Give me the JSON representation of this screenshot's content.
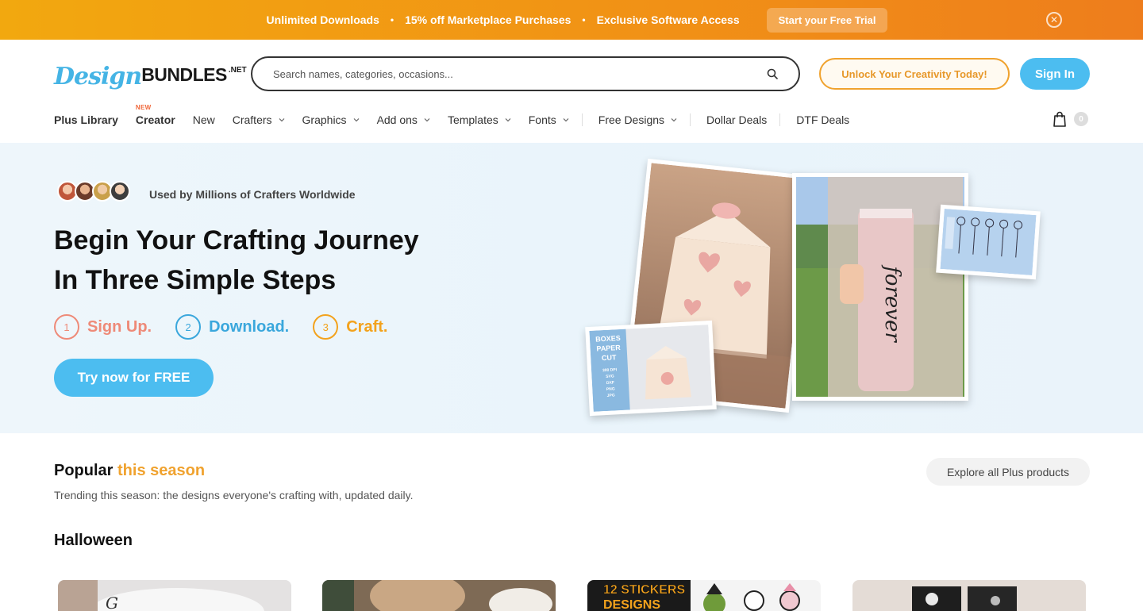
{
  "promo": {
    "items": [
      "Unlimited Downloads",
      "15% off Marketplace Purchases",
      "Exclusive Software Access"
    ],
    "separator": "•",
    "cta": "Start your Free Trial",
    "close_glyph": "✕"
  },
  "header": {
    "logo": {
      "part1": "Design",
      "part2": "BUNDLES",
      "part3": ".NET"
    },
    "search_placeholder": "Search names, categories, occasions...",
    "unlock_label": "Unlock Your Creativity Today!",
    "signin_label": "Sign In",
    "cart_count": "0"
  },
  "nav": {
    "items": [
      {
        "label": "Plus Library"
      },
      {
        "label": "Creator",
        "badge": "NEW"
      },
      {
        "label": "New"
      },
      {
        "label": "Crafters"
      },
      {
        "label": "Graphics"
      },
      {
        "label": "Add ons"
      },
      {
        "label": "Templates"
      },
      {
        "label": "Fonts"
      },
      {
        "label": "Free Designs"
      },
      {
        "label": "Dollar Deals"
      },
      {
        "label": "DTF Deals"
      }
    ]
  },
  "hero": {
    "used_by": "Used by Millions of Crafters Worldwide",
    "title_line1": "Begin Your Crafting Journey",
    "title_line2": "In Three Simple Steps",
    "steps": [
      {
        "num": "1",
        "label": "Sign Up.",
        "color": "#ee8a78"
      },
      {
        "num": "2",
        "label": "Download.",
        "color": "#3aa7dc"
      },
      {
        "num": "3",
        "label": "Craft.",
        "color": "#f3a21c"
      }
    ],
    "cta": "Try now for FREE",
    "box_card_text": [
      "BOXES",
      "PAPER",
      "CUT"
    ],
    "box_card_formats": [
      "300 DPI",
      "SVG",
      "DXF",
      "PNG",
      "JPG"
    ],
    "tumbler_text": "forever"
  },
  "popular": {
    "title_main": "Popular",
    "title_accent": "this season",
    "subtitle": "Trending this season: the designs everyone's crafting with, updated daily.",
    "explore_label": "Explore all Plus products",
    "section_title": "Halloween",
    "sticker_text": [
      "12 STICKERS",
      "DESIGNS"
    ]
  },
  "colors": {
    "accent_blue": "#4cbdf0",
    "accent_orange": "#f0a22e",
    "promo_gradient_start": "#f2a80f",
    "promo_gradient_end": "#ee7d1c"
  }
}
